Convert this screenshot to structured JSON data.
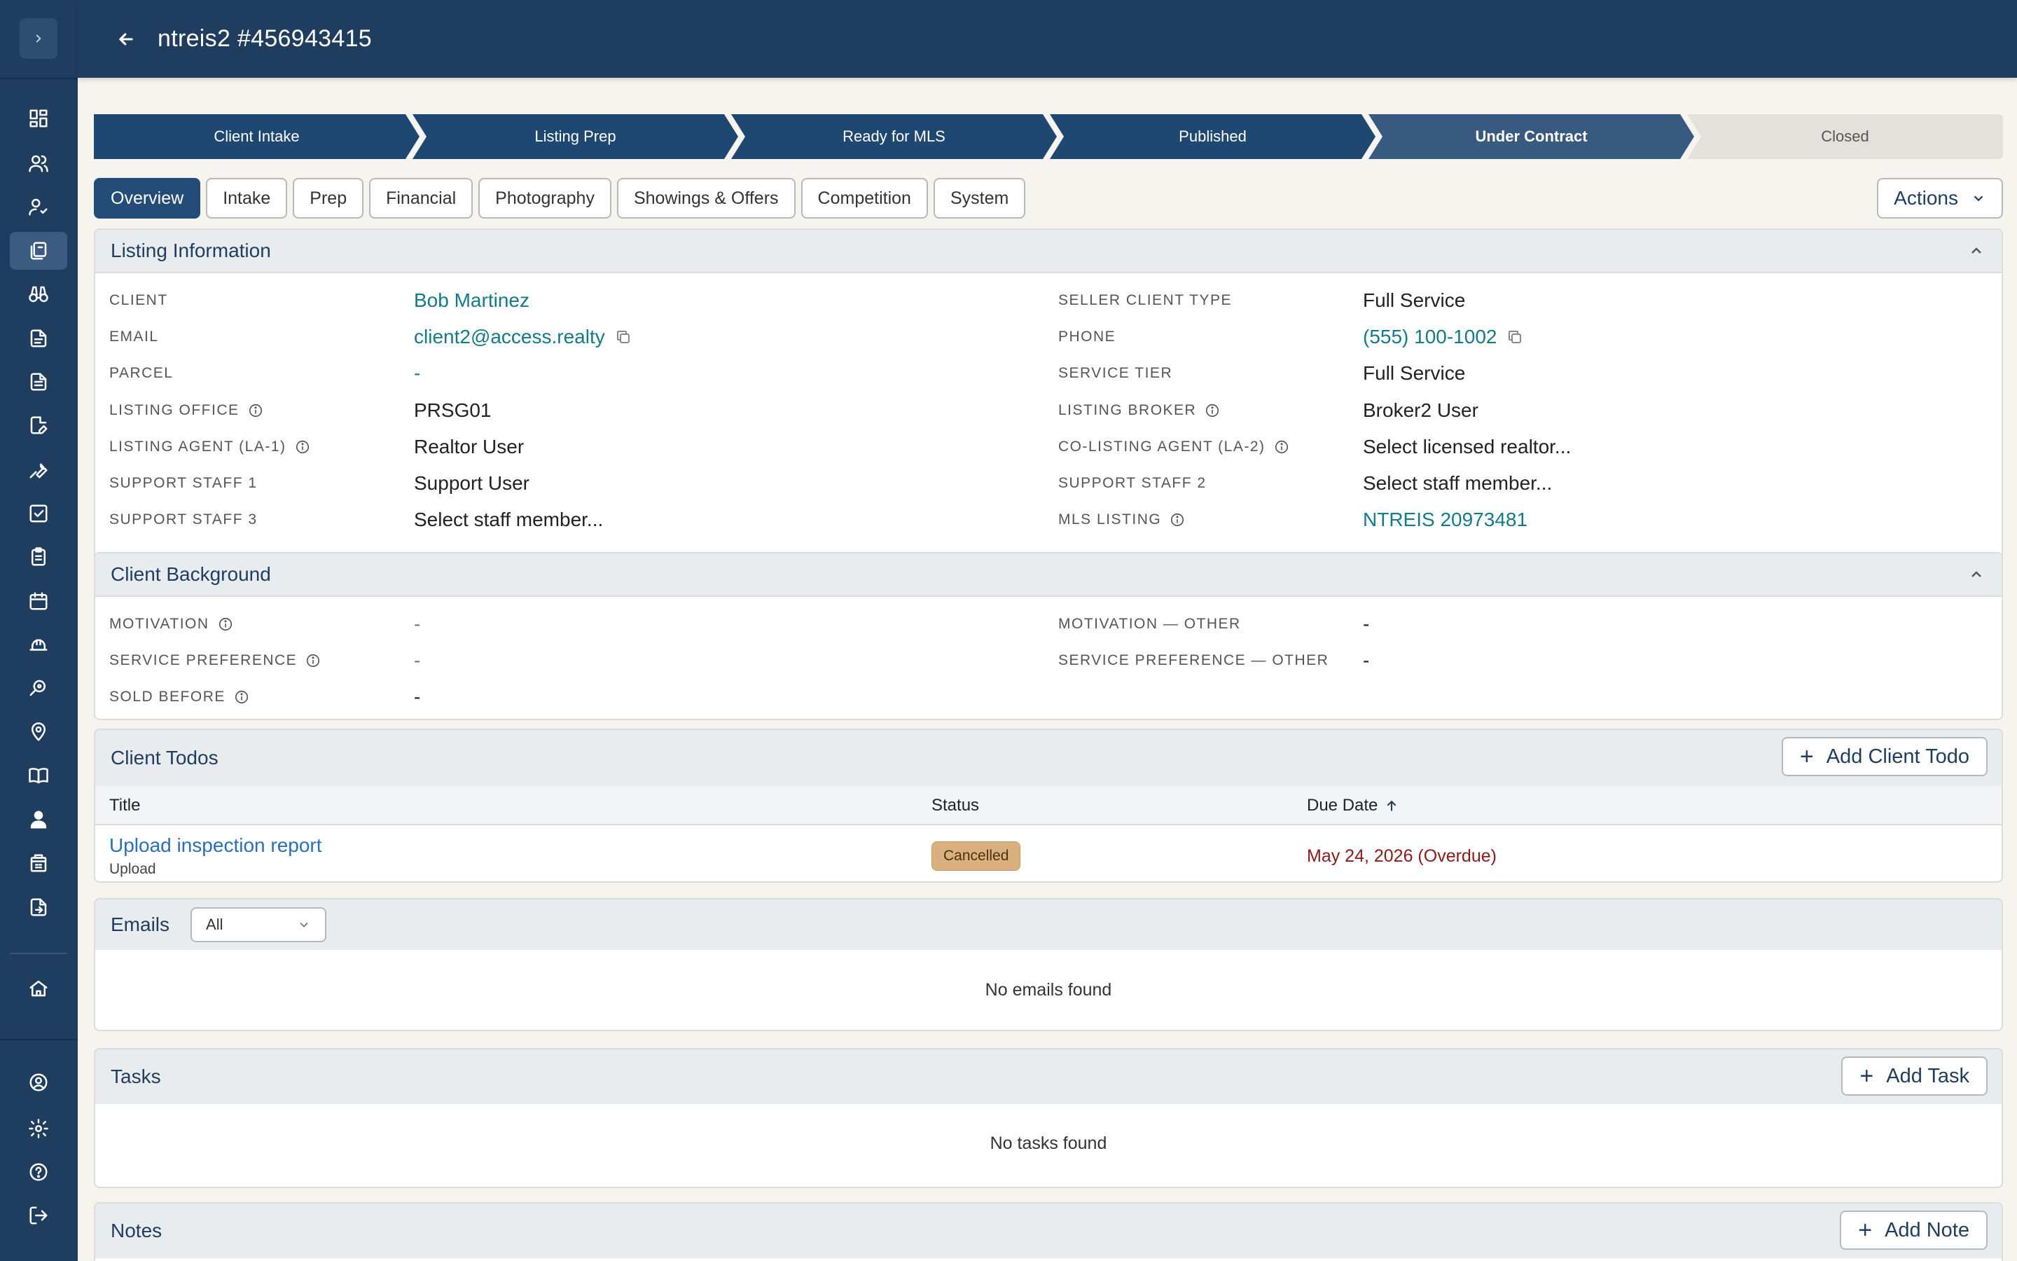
{
  "header": {
    "title": "ntreis2 #456943415"
  },
  "sidebar": {
    "items": [
      {
        "icon": "dashboard-icon"
      },
      {
        "icon": "users-icon"
      },
      {
        "icon": "user-check-icon"
      },
      {
        "icon": "listings-icon",
        "active": true
      },
      {
        "icon": "binoculars-icon"
      },
      {
        "icon": "document-icon"
      },
      {
        "icon": "document-lines-icon"
      },
      {
        "icon": "document-edit-icon"
      },
      {
        "icon": "wrench-icon"
      },
      {
        "icon": "checkbox-icon"
      },
      {
        "icon": "clipboard-icon"
      },
      {
        "icon": "calendar-icon"
      },
      {
        "icon": "hard-hat-icon"
      },
      {
        "icon": "search-location-icon"
      },
      {
        "icon": "map-pin-icon"
      },
      {
        "icon": "book-icon"
      },
      {
        "icon": "user-tie-icon"
      },
      {
        "icon": "building-icon"
      },
      {
        "icon": "file-export-icon"
      },
      {
        "icon": "home-icon"
      },
      {
        "icon": "account-circle-icon"
      },
      {
        "icon": "settings-icon"
      },
      {
        "icon": "help-icon"
      },
      {
        "icon": "logout-icon"
      }
    ]
  },
  "stepper": {
    "steps": [
      {
        "label": "Client Intake",
        "state": "done"
      },
      {
        "label": "Listing Prep",
        "state": "done"
      },
      {
        "label": "Ready for MLS",
        "state": "done"
      },
      {
        "label": "Published",
        "state": "done"
      },
      {
        "label": "Under Contract",
        "state": "current"
      },
      {
        "label": "Closed",
        "state": "todo"
      }
    ]
  },
  "tabs": [
    "Overview",
    "Intake",
    "Prep",
    "Financial",
    "Photography",
    "Showings & Offers",
    "Competition",
    "System"
  ],
  "actions_label": "Actions",
  "listing_info": {
    "title": "Listing Information",
    "left": [
      {
        "label": "CLIENT",
        "value": "Bob Martinez"
      },
      {
        "label": "EMAIL",
        "value": "client2@access.realty"
      },
      {
        "label": "PARCEL",
        "value": "-"
      },
      {
        "label": "LISTING OFFICE",
        "value": "PRSG01"
      },
      {
        "label": "LISTING AGENT (LA-1)",
        "value": "Realtor User"
      },
      {
        "label": "SUPPORT STAFF 1",
        "value": "Support User"
      },
      {
        "label": "SUPPORT STAFF 3",
        "value": "Select staff member..."
      }
    ],
    "right": [
      {
        "label": "SELLER CLIENT TYPE",
        "value": "Full Service"
      },
      {
        "label": "PHONE",
        "value": "(555) 100-1002"
      },
      {
        "label": "SERVICE TIER",
        "value": "Full Service"
      },
      {
        "label": "LISTING BROKER",
        "value": "Broker2 User"
      },
      {
        "label": "CO-LISTING AGENT (LA-2)",
        "value": "Select licensed realtor..."
      },
      {
        "label": "SUPPORT STAFF 2",
        "value": "Select staff member..."
      },
      {
        "label": "MLS LISTING",
        "value": "NTREIS 20973481"
      }
    ]
  },
  "client_background": {
    "title": "Client Background",
    "left": [
      {
        "label": "MOTIVATION",
        "value": "-"
      },
      {
        "label": "SERVICE PREFERENCE",
        "value": "-"
      },
      {
        "label": "SOLD BEFORE",
        "value": "-"
      }
    ],
    "right": [
      {
        "label": "MOTIVATION — OTHER",
        "value": "-"
      },
      {
        "label": "SERVICE PREFERENCE — OTHER",
        "value": "-"
      }
    ]
  },
  "client_todos": {
    "title": "Client Todos",
    "add_label": "Add Client Todo",
    "columns": {
      "title": "Title",
      "status": "Status",
      "due": "Due Date"
    },
    "rows": [
      {
        "title": "Upload inspection report",
        "subtitle": "Upload",
        "status": "Cancelled",
        "due": "May 24, 2026 (Overdue)"
      }
    ]
  },
  "emails": {
    "title": "Emails",
    "filter": "All",
    "empty": "No emails found"
  },
  "tasks": {
    "title": "Tasks",
    "add_label": "Add Task",
    "empty": "No tasks found"
  },
  "notes": {
    "title": "Notes",
    "add_label": "Add Note"
  },
  "colors": {
    "brand": "#1e3d5f",
    "link": "#147a87",
    "overdue": "#8b1a1a",
    "badge": "#d9b07e"
  }
}
